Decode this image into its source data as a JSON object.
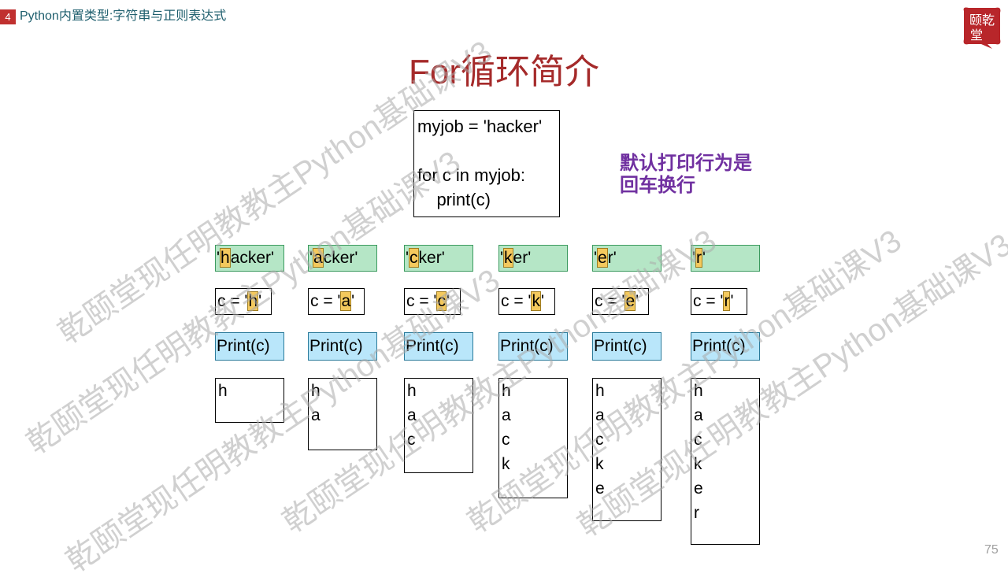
{
  "header": {
    "chapter_number": "4",
    "chapter_title": "Python内置类型:字符串与正则表达式",
    "logo_text": "颐乾堂"
  },
  "slide": {
    "title": "For循环简介",
    "code": "myjob = 'hacker'\n\nfor c in myjob:\n    print(c)",
    "note_line1": "默认打印行为是",
    "note_line2": "回车换行",
    "page_number": "75"
  },
  "steps": [
    {
      "pre": "'",
      "char": "h",
      "post": "acker'",
      "assign_pre": "c = '",
      "assign_char": "h",
      "assign_post": "'",
      "print": "Print(c)",
      "output": [
        "h"
      ]
    },
    {
      "pre": "'",
      "char": "a",
      "post": "cker'",
      "assign_pre": "c = '",
      "assign_char": "a",
      "assign_post": "'",
      "print": "Print(c)",
      "output": [
        "h",
        "a"
      ]
    },
    {
      "pre": "'",
      "char": "c",
      "post": "ker'",
      "assign_pre": "c = '",
      "assign_char": "c",
      "assign_post": "'",
      "print": "Print(c)",
      "output": [
        "h",
        "a",
        "c"
      ]
    },
    {
      "pre": "'",
      "char": "k",
      "post": "er'",
      "assign_pre": "c = '",
      "assign_char": "k",
      "assign_post": "'",
      "print": "Print(c)",
      "output": [
        "h",
        "a",
        "c",
        "k"
      ]
    },
    {
      "pre": "'",
      "char": "e",
      "post": "r'",
      "assign_pre": "c = '",
      "assign_char": "e",
      "assign_post": "'",
      "print": "Print(c)",
      "output": [
        "h",
        "a",
        "c",
        "k",
        "e"
      ]
    },
    {
      "pre": "'",
      "char": "r",
      "post": "'",
      "assign_pre": "c = '",
      "assign_char": "r",
      "assign_post": "'",
      "print": "Print(c)",
      "output": [
        "h",
        "a",
        "c",
        "k",
        "e",
        "r"
      ]
    }
  ],
  "watermark_text": "乾颐堂现任明教教主Python基础课V3",
  "colors": {
    "title": "#a52a2a",
    "note": "#7030a0",
    "string_box": "#b5e6c6",
    "print_box": "#b9e6fa",
    "highlight": "#f4c95d"
  }
}
